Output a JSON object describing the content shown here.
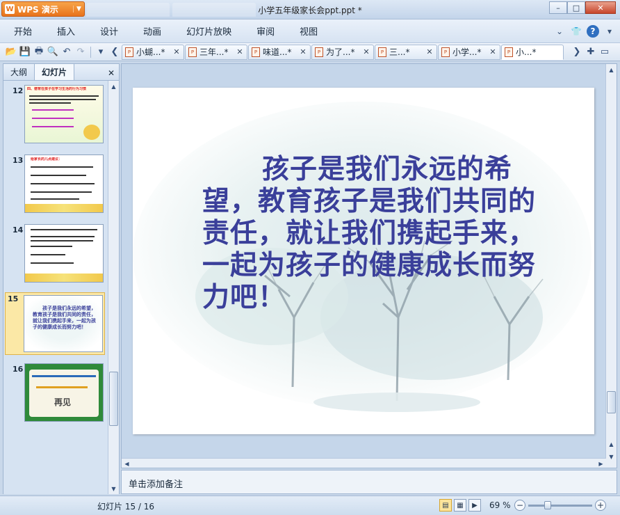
{
  "app": {
    "button_label": "WPS 演示",
    "logo_glyph": "W",
    "window_title": "小学五年级家长会ppt.ppt *"
  },
  "window_controls": {
    "minimize": "–",
    "maximize": "□",
    "close": "✕"
  },
  "menu": {
    "items": [
      "开始",
      "插入",
      "设计",
      "动画",
      "幻灯片放映",
      "审阅",
      "视图"
    ]
  },
  "doc_tabs": [
    {
      "label": "小蝴...*",
      "close": "✕"
    },
    {
      "label": "三年...*",
      "close": "✕"
    },
    {
      "label": "味道...*",
      "close": "✕"
    },
    {
      "label": "为了...*",
      "close": "✕"
    },
    {
      "label": "三...*",
      "close": "✕"
    },
    {
      "label": "小学...*",
      "close": "✕"
    },
    {
      "label": "小...*",
      "close": ""
    }
  ],
  "left_panel": {
    "tab_outline": "大纲",
    "tab_slides": "幻灯片",
    "close": "✕",
    "thumbnails": [
      {
        "num": "12",
        "title": "四、德育在孩子在学习生活的行为习惯"
      },
      {
        "num": "13",
        "title": "给家长的几点建议："
      },
      {
        "num": "14",
        "title": ""
      },
      {
        "num": "15",
        "title": "孩子是我们永远的希望，教育孩子是我们共同的责任，就让我们携起手来，一起为孩子的健康成长而努力吧！"
      },
      {
        "num": "16",
        "title": "再见"
      }
    ],
    "selected_index": 3
  },
  "slide": {
    "body_text": "孩子是我们永远的希望，教育孩子是我们共同的责任，就让我们携起手来，一起为孩子的健康成长而努力吧！"
  },
  "notes": {
    "placeholder": "单击添加备注"
  },
  "status": {
    "slide_counter": "幻灯片 15 / 16",
    "zoom": "69 %",
    "zoom_fraction": 0.3
  },
  "colors": {
    "slide_text": "#3a3f9a",
    "wps_orange": "#e8731c",
    "selection": "#fbe8a6"
  }
}
